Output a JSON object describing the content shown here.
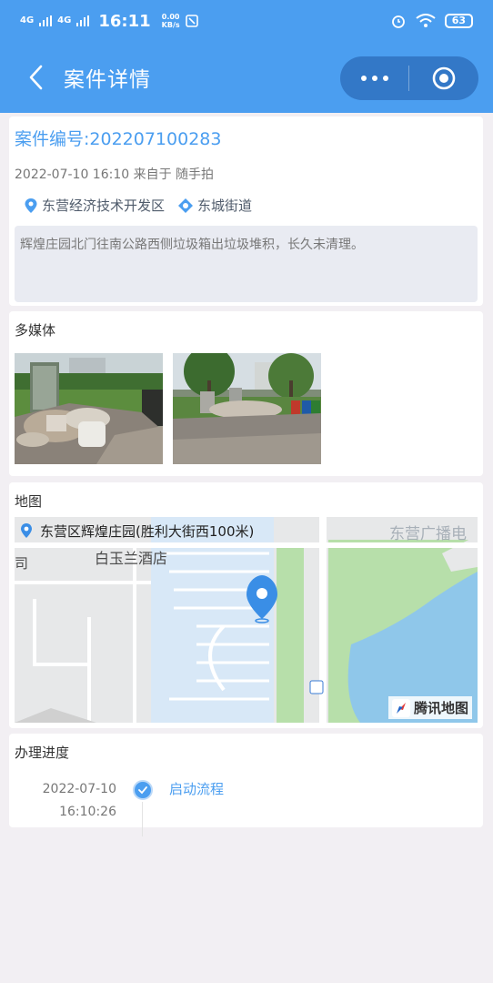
{
  "status_bar": {
    "network1": "4G",
    "network2": "4G",
    "time": "16:11",
    "speed_value": "0.00",
    "speed_unit": "KB/s",
    "battery": "63"
  },
  "header": {
    "title": "案件详情",
    "back_icon": "chevron-left-icon",
    "more_icon": "more-dots-icon",
    "close_icon": "target-close-icon"
  },
  "case": {
    "number": "案件编号:202207100283",
    "meta": "2022-07-10 16:10 来自于 随手拍",
    "district": "东营经济技术开发区",
    "street": "东城街道",
    "description": "辉煌庄园北门往南公路西侧垃圾箱出垃圾堆积，长久未清理。"
  },
  "media": {
    "title": "多媒体",
    "photos": [
      "photo-1",
      "photo-2"
    ]
  },
  "map": {
    "title": "地图",
    "address": "东营区辉煌庄园(胜利大街西100米)",
    "label_hotel": "白玉兰酒店",
    "label_top_right": "东营广播电",
    "label_left": "司",
    "provider": "腾讯地图"
  },
  "progress": {
    "title": "办理进度",
    "steps": [
      {
        "date": "2022-07-10",
        "time": "16:10:26",
        "label": "启动流程"
      }
    ]
  },
  "colors": {
    "accent": "#4b9ef0",
    "capsule": "#3378c7",
    "background": "#f2eff3"
  }
}
